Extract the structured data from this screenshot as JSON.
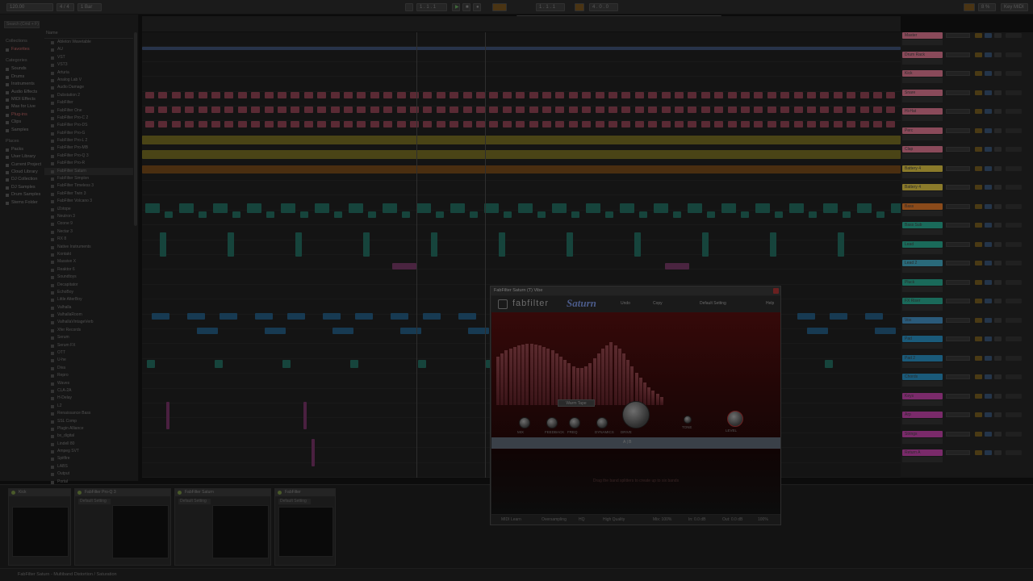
{
  "transport": {
    "tempo": "120.00",
    "sig": "4 / 4",
    "quant": "1 Bar",
    "position": "1 . 1 . 1",
    "loop_start": "1 . 1 . 1",
    "loop_len": "4 . 0 . 0",
    "cpu": "8 %",
    "midi": "Key MIDI"
  },
  "browser": {
    "search_placeholder": "Search (Cmd + F)",
    "favorites_head": "Collections",
    "favorites": [
      "Favorites"
    ],
    "categories_head": "Categories",
    "categories": [
      "Sounds",
      "Drums",
      "Instruments",
      "Audio Effects",
      "MIDI Effects",
      "Max for Live",
      "Plug-ins",
      "Clips",
      "Samples"
    ],
    "places_head": "Places",
    "places": [
      "Packs",
      "User Library",
      "Current Project",
      "Cloud Library",
      "DJ Collection",
      "DJ Samples",
      "Drum Samples",
      "Stems Folder"
    ],
    "list_head": "Name",
    "files": [
      "Ableton Wavetable",
      "AU",
      "VST",
      "VST3",
      "Arturia",
      "Analog Lab V",
      "Audio Damage",
      "Dubstation 2",
      "FabFilter",
      "FabFilter One",
      "FabFilter Pro-C 2",
      "FabFilter Pro-DS",
      "FabFilter Pro-G",
      "FabFilter Pro-L 2",
      "FabFilter Pro-MB",
      "FabFilter Pro-Q 3",
      "FabFilter Pro-R",
      "FabFilter Saturn",
      "FabFilter Simplon",
      "FabFilter Timeless 3",
      "FabFilter Twin 3",
      "FabFilter Volcano 3",
      "iZotope",
      "Neutron 3",
      "Ozone 9",
      "Nectar 3",
      "RX 8",
      "Native Instruments",
      "Kontakt",
      "Massive X",
      "Reaktor 6",
      "Soundtoys",
      "Decapitator",
      "EchoBoy",
      "Little AlterBoy",
      "Valhalla",
      "ValhallaRoom",
      "ValhallaVintageVerb",
      "Xfer Records",
      "Serum",
      "Serum FX",
      "OTT",
      "U-he",
      "Diva",
      "Repro",
      "Waves",
      "CLA-2A",
      "H-Delay",
      "L2",
      "Renaissance Bass",
      "SSL Comp",
      "Plugin Alliance",
      "bx_digital",
      "Lindell 80",
      "Ampeg SVT",
      "Spitfire",
      "LABS",
      "Output",
      "Portal",
      "Thermal"
    ]
  },
  "tracks": [
    {
      "name": "Master",
      "color": "#8a4a5a"
    },
    {
      "name": "Drum Rack",
      "color": "#8a4a5a"
    },
    {
      "name": "Kick",
      "color": "#8a4a5a"
    },
    {
      "name": "Snare",
      "color": "#8a4a5a"
    },
    {
      "name": "Hi-Hat",
      "color": "#8a4a5a"
    },
    {
      "name": "Perc",
      "color": "#8a4a5a"
    },
    {
      "name": "Clap",
      "color": "#8a4a5a"
    },
    {
      "name": "Battery 4",
      "color": "#8a7a2a"
    },
    {
      "name": "Battery 4",
      "color": "#8a7a2a"
    },
    {
      "name": "Bass",
      "color": "#8a4a1a"
    },
    {
      "name": "Bass Sub",
      "color": "#1a6a5a"
    },
    {
      "name": "Lead",
      "color": "#1a6a5a"
    },
    {
      "name": "Lead 2",
      "color": "#2a6a7a"
    },
    {
      "name": "Pluck",
      "color": "#1a6a5a"
    },
    {
      "name": "FX Riser",
      "color": "#1a6a5a"
    },
    {
      "name": "Vox",
      "color": "#2a5a7a"
    },
    {
      "name": "Pad",
      "color": "#1a5a7a"
    },
    {
      "name": "Pad 2",
      "color": "#1a5a7a"
    },
    {
      "name": "Chords",
      "color": "#1a5a7a"
    },
    {
      "name": "Keys",
      "color": "#7a2a6a"
    },
    {
      "name": "Arp",
      "color": "#7a2a6a"
    },
    {
      "name": "Strings",
      "color": "#7a2a6a"
    },
    {
      "name": "Return A",
      "color": "#7a2a6a"
    }
  ],
  "devices": [
    {
      "title": "Kick"
    },
    {
      "title": "FabFilter Pro-Q 3"
    },
    {
      "title": "FabFilter Saturn"
    },
    {
      "title": "FabFilter"
    }
  ],
  "device_presets": [
    "Default",
    "Default Setting",
    "Default Setting",
    "Default Setting"
  ],
  "status_text": "FabFilter Saturn - Multiband Distortion / Saturation",
  "plugin": {
    "window_title": "FabFilter Saturn (T) Vibe",
    "brand": "fabfilter",
    "product": "Saturn",
    "preset": "Default Setting",
    "undo": "Undo",
    "copy": "Copy",
    "help": "Help",
    "style": "Warm Tape",
    "knobs": [
      {
        "label": "MIX"
      },
      {
        "label": "FEEDBACK"
      },
      {
        "label": "FREQ"
      },
      {
        "label": "DYNAMICS"
      },
      {
        "label": "DRIVE"
      },
      {
        "label": "TONE"
      },
      {
        "label": "LEVEL"
      }
    ],
    "footer_label": "A | B",
    "hint": "Drag the band splitters to create up to six bands",
    "bottom": {
      "midi": "MIDI Learn",
      "oversampling": "Oversampling",
      "hq": "HQ",
      "quality": "High Quality",
      "mix": "Mix: 100%",
      "in": "In: 0.0 dB",
      "out": "Out: 0.0 dB",
      "zoom": "100%"
    }
  }
}
